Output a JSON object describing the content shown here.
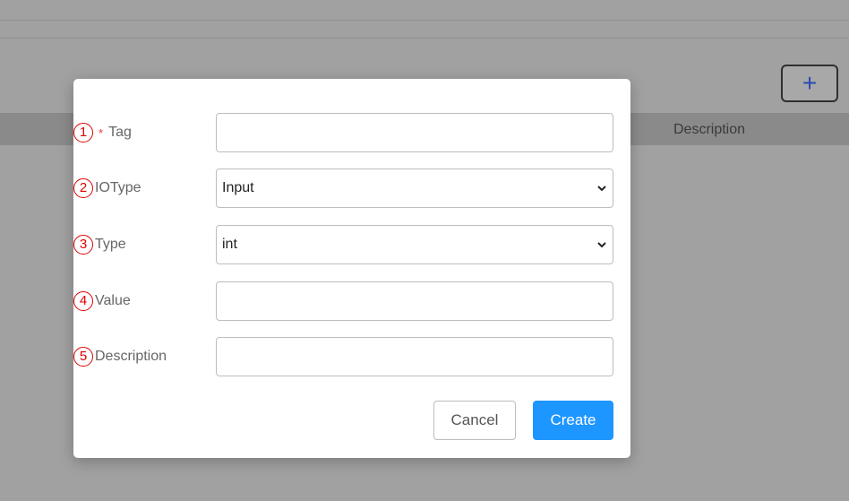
{
  "background": {
    "add_button_label": "+",
    "table_header_description": "Description"
  },
  "form": {
    "fields": [
      {
        "number": "1",
        "label": "Tag",
        "required": true,
        "value": "",
        "placeholder": ""
      },
      {
        "number": "2",
        "label": "IOType",
        "value": "Input"
      },
      {
        "number": "3",
        "label": "Type",
        "value": "int"
      },
      {
        "number": "4",
        "label": "Value",
        "value": "",
        "placeholder": ""
      },
      {
        "number": "5",
        "label": "Description",
        "value": "",
        "placeholder": ""
      }
    ],
    "required_marker": "*",
    "cancel_label": "Cancel",
    "create_label": "Create"
  },
  "colors": {
    "overlay": "#a1a1a1",
    "primary": "#1e96ff",
    "annotation_red": "#e00000"
  }
}
